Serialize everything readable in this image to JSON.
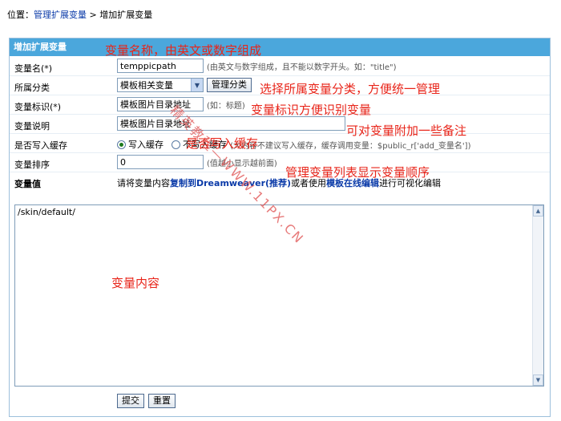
{
  "breadcrumb": {
    "prefix": "位置：",
    "link": "管理扩展变量",
    "separator": " > ",
    "current": "增加扩展变量"
  },
  "panel": {
    "title": "增加扩展变量"
  },
  "form": {
    "var_name": {
      "label": "变量名(*)",
      "value": "temppicpath",
      "hint": "(由英文与数字组成，且不能以数字开头。如：\"title\")"
    },
    "category": {
      "label": "所属分类",
      "selected": "模板相关变量",
      "manage_button": "管理分类"
    },
    "var_title": {
      "label": "变量标识(*)",
      "value": "模板图片目录地址",
      "hint": "(如：标题)"
    },
    "var_desc": {
      "label": "变量说明",
      "value": "模板图片目录地址"
    },
    "cache": {
      "label": "是否写入缓存",
      "option_yes": "写入缓存",
      "option_no": "不写入缓存",
      "hint": "(大内容不建议写入缓存，缓存调用变量：$public_r['add_变量名'])"
    },
    "order": {
      "label": "变量排序",
      "value": "0",
      "hint": "(值越小显示越前面)"
    },
    "var_value": {
      "label": "变量值",
      "note_pre": "请将变量内容",
      "note_bold": "复制到Dreamweaver(推荐)",
      "note_mid": "或者使用",
      "note_bold2": "模板在线编辑",
      "note_post": "进行可视化编辑",
      "content": "/skin/default/"
    }
  },
  "buttons": {
    "submit": "提交",
    "reset": "重置"
  },
  "annotations": {
    "name": "变量名称，由英文或数字组成",
    "category": "选择所属变量分类，方便统一管理",
    "title": "变量标识方便识别变量",
    "desc": "可对变量附加一些备注",
    "cache": "是否写入缓存",
    "order": "管理变量列表显示变量顺序",
    "content": "变量内容"
  },
  "watermark": "精英教程—WWW.11PX.CN",
  "colors": {
    "header_bg": "#4ba7dc",
    "annotation": "#e8251a",
    "link": "#0a3aa8"
  }
}
